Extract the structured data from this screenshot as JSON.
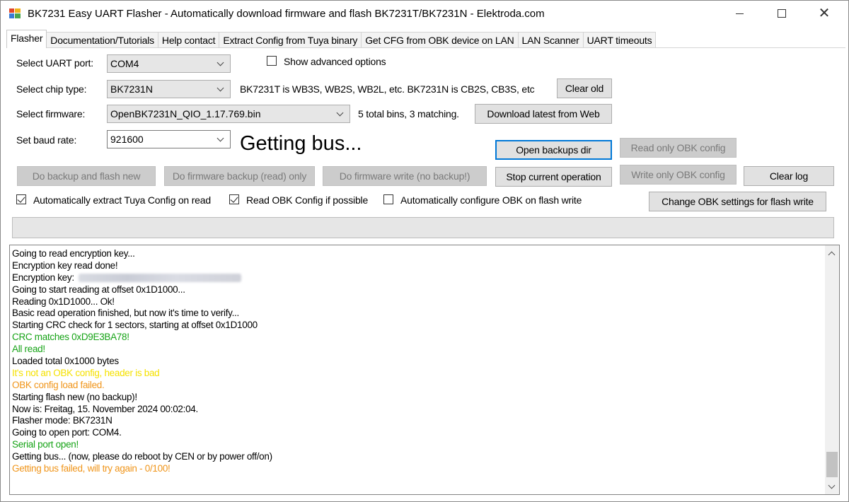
{
  "window": {
    "title": "BK7231 Easy UART Flasher - Automatically download firmware and flash BK7231T/BK7231N  - Elektroda.com",
    "minimize_label": "—",
    "maximize_label": "☐",
    "close_label": "✕"
  },
  "tabs": [
    {
      "label": "Flasher",
      "active": true
    },
    {
      "label": "Documentation/Tutorials",
      "active": false
    },
    {
      "label": "Help contact",
      "active": false
    },
    {
      "label": "Extract Config from Tuya binary",
      "active": false
    },
    {
      "label": "Get CFG from OBK device on LAN",
      "active": false
    },
    {
      "label": "LAN Scanner",
      "active": false
    },
    {
      "label": "UART timeouts",
      "active": false
    }
  ],
  "form": {
    "uart_port_label": "Select UART port:",
    "uart_port_value": "COM4",
    "show_advanced_label": "Show advanced options",
    "show_advanced_checked": false,
    "chip_type_label": "Select chip type:",
    "chip_type_value": "BK7231N",
    "chip_info": "BK7231T is WB3S, WB2S, WB2L, etc. BK7231N is CB2S, CB3S, etc",
    "firmware_label": "Select firmware:",
    "firmware_value": "OpenBK7231N_QIO_1.17.769.bin",
    "bins_info": "5 total bins, 3 matching.",
    "baud_label": "Set baud rate:",
    "baud_value": "921600",
    "status_text": "Getting bus..."
  },
  "buttons": {
    "clear_old": "Clear old",
    "download_latest": "Download latest from Web",
    "open_backups": "Open backups dir",
    "read_only_obk": "Read only OBK config",
    "do_backup_flash": "Do backup and flash new",
    "do_firmware_backup": "Do firmware backup (read) only",
    "do_firmware_write": "Do firmware write (no backup!)",
    "stop_current": "Stop current operation",
    "write_only_obk": "Write only OBK config",
    "clear_log": "Clear log",
    "change_obk_settings": "Change OBK settings for flash write"
  },
  "checkboxes": {
    "auto_extract_label": "Automatically extract Tuya Config on read",
    "auto_extract_checked": true,
    "read_obk_label": "Read OBK Config if possible",
    "read_obk_checked": true,
    "auto_configure_label": "Automatically configure OBK on flash write",
    "auto_configure_checked": false
  },
  "colors": {
    "log_green": "#16a316",
    "log_yellow": "#f5e100",
    "log_orange": "#f0951a",
    "focus_blue": "#0078d7"
  },
  "log": [
    {
      "text": "Going to read encryption key...",
      "color": "black"
    },
    {
      "text": "Encryption key read done!",
      "color": "black"
    },
    {
      "text": "Encryption key:",
      "color": "black",
      "redacted": true
    },
    {
      "text": "Going to start reading at offset 0x1D1000...",
      "color": "black"
    },
    {
      "text": "Reading 0x1D1000... Ok!",
      "color": "black"
    },
    {
      "text": "Basic read operation finished, but now it's time to verify...",
      "color": "black"
    },
    {
      "text": "Starting CRC check for 1 sectors, starting at offset 0x1D1000",
      "color": "black"
    },
    {
      "text": "CRC matches 0xD9E3BA78!",
      "color": "green"
    },
    {
      "text": "All read!",
      "color": "green"
    },
    {
      "text": "Loaded total 0x1000 bytes",
      "color": "black"
    },
    {
      "text": "It's not an OBK config, header is bad",
      "color": "yellow"
    },
    {
      "text": "OBK config load failed.",
      "color": "orange"
    },
    {
      "text": "Starting flash new (no backup)!",
      "color": "black"
    },
    {
      "text": "Now is: Freitag, 15. November 2024 00:02:04.",
      "color": "black"
    },
    {
      "text": "Flasher mode: BK7231N",
      "color": "black"
    },
    {
      "text": "Going to open port: COM4.",
      "color": "black"
    },
    {
      "text": "Serial port open!",
      "color": "green"
    },
    {
      "text": "Getting bus... (now, please do reboot by CEN or by power off/on)",
      "color": "black"
    },
    {
      "text": "Getting bus failed, will try again - 0/100!",
      "color": "orange"
    }
  ]
}
